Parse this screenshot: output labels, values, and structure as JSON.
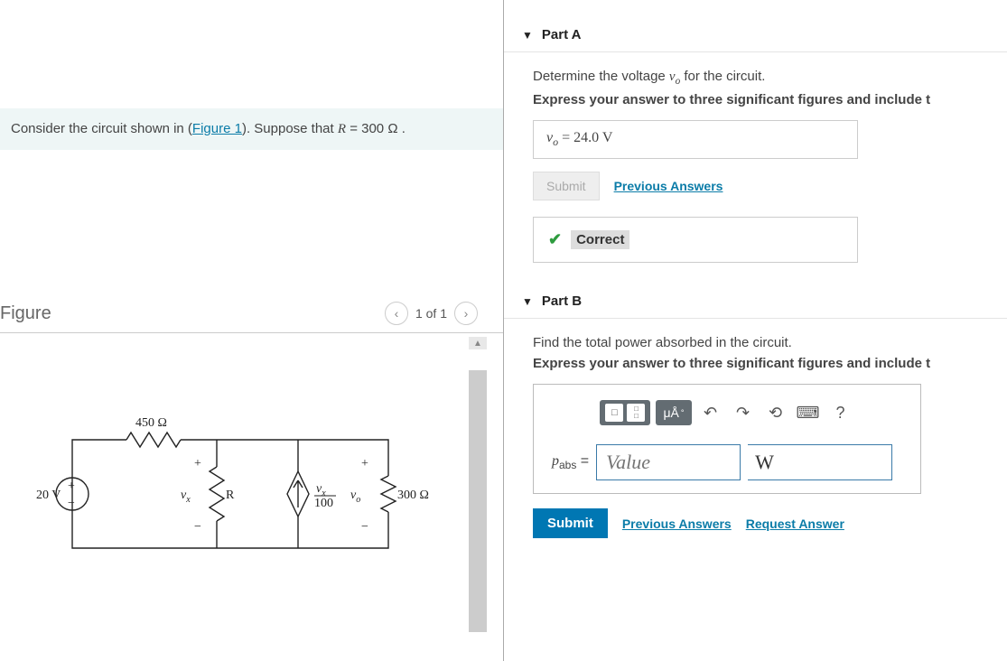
{
  "problem": {
    "prefix": "Consider the circuit shown in (",
    "figure_link": "Figure 1",
    "suffix": "). Suppose that ",
    "var": "R",
    "equals": " = 300  Ω .",
    "figure_heading": "Figure",
    "nav_current": "1 of 1"
  },
  "circuit": {
    "source_voltage": "20 V",
    "r1_label": "450 Ω",
    "vx_label": "v",
    "vx_sub": "x",
    "r_mid": "R",
    "dep_source_num": "v",
    "dep_source_num_sub": "x",
    "dep_source_denom": "100",
    "vo_label": "v",
    "vo_sub": "o",
    "r_right": "300 Ω"
  },
  "partA": {
    "title": "Part A",
    "prompt_prefix": "Determine the voltage ",
    "prompt_var": "v",
    "prompt_sub": "o",
    "prompt_suffix": " for the circuit.",
    "subprompt": "Express your answer to three significant figures and include t",
    "answer_var": "v",
    "answer_sub": "o",
    "answer_eq": " =  24.0 V",
    "submit": "Submit",
    "prev_answers": "Previous Answers",
    "correct": "Correct"
  },
  "partB": {
    "title": "Part B",
    "prompt": "Find the total power absorbed in the circuit.",
    "subprompt": "Express your answer to three significant figures and include t",
    "units_btn": "μÅ",
    "var_label_main": "p",
    "var_label_sub": "abs",
    "eq": " = ",
    "value_placeholder": "Value",
    "unit_value": "W",
    "submit": "Submit",
    "prev_answers": "Previous Answers",
    "request_answer": "Request Answer",
    "help": "?"
  }
}
